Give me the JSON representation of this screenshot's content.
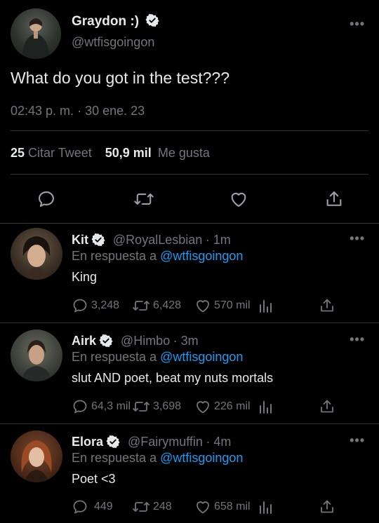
{
  "main": {
    "author_name": "Graydon :)",
    "author_handle": "@wtfisgoingon",
    "text": "What do you got in the test???",
    "timestamp": "02:43 p. m.",
    "separator": "·",
    "date": "30 ene. 23",
    "quotes_count": "25",
    "quotes_label": "Citar Tweet",
    "likes_count": "50,9 mil",
    "likes_label": "Me gusta",
    "more": "•••"
  },
  "replying_to_label": "En respuesta a",
  "replies": [
    {
      "name": "Kit",
      "handle": "@RoyalLesbian",
      "time": "· 1m",
      "replying_to": "@wtfisgoingon",
      "text": "King",
      "reply_count": "3,248",
      "retweet_count": "6,428",
      "like_count": "570 mil"
    },
    {
      "name": "Airk",
      "handle": "@Himbo",
      "time": "· 3m",
      "replying_to": "@wtfisgoingon",
      "text": "slut AND poet, beat my nuts mortals",
      "reply_count": "64,3 mil",
      "retweet_count": "3,698",
      "like_count": "226 mil"
    },
    {
      "name": "Elora",
      "handle": "@Fairymuffin",
      "time": "· 4m",
      "replying_to": "@wtfisgoingon",
      "text": "Poet <3",
      "reply_count": "449",
      "retweet_count": "248",
      "like_count": "658 mil"
    }
  ],
  "colors": {
    "background": "#000000",
    "text": "#e7e9ea",
    "muted": "#71767b",
    "link": "#1d9bf0",
    "divider": "#2f3336"
  }
}
